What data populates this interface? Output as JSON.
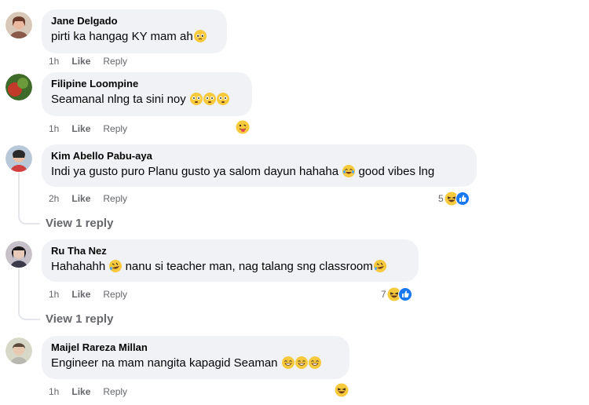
{
  "comments": [
    {
      "name": "Jane Delgado",
      "text": "pirti ka hangag KY mam ah",
      "time": "1h",
      "like": "Like",
      "reply": "Reply"
    },
    {
      "name": "Filipine Loompine",
      "text": "Seamanal nlng ta sini noy",
      "time": "1h",
      "like": "Like",
      "reply": "Reply"
    },
    {
      "name": "Kim Abello Pabu-aya",
      "text": "Indi ya gusto puro Planu gusto ya salom dayun hahaha",
      "text2": "good vibes lng",
      "time": "2h",
      "like": "Like",
      "reply": "Reply",
      "reaction_count": "5",
      "view_replies": "View 1 reply"
    },
    {
      "name": "Ru Tha Nez",
      "text": "Hahahahh",
      "text2": "nanu si teacher man, nag talang sng classroom",
      "time": "1h",
      "like": "Like",
      "reply": "Reply",
      "reaction_count": "7",
      "view_replies": "View 1 reply"
    },
    {
      "name": "Maijel Rareza Millan",
      "text": "Engineer na mam nangita kapagid Seaman",
      "time": "1h",
      "like": "Like",
      "reply": "Reply"
    }
  ],
  "colors": {
    "bubble": "#f0f2f5",
    "meta": "#65676b",
    "like_blue": "#1877f2",
    "emoji_yellow": "#f7c93c"
  }
}
